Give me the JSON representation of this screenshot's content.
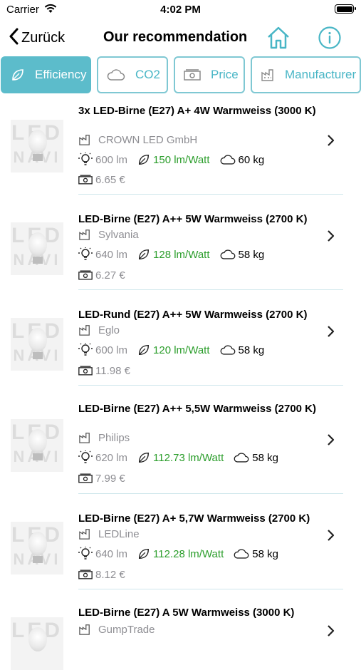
{
  "status": {
    "carrier": "Carrier",
    "time": "4:02 PM"
  },
  "nav": {
    "back_label": "Zurück",
    "title": "Our recommendation"
  },
  "filters": [
    {
      "label": "Efficiency",
      "icon": "leaf-icon",
      "active": true
    },
    {
      "label": "CO2",
      "icon": "cloud-icon",
      "active": false
    },
    {
      "label": "Price",
      "icon": "banknote-icon",
      "active": false
    },
    {
      "label": "Manufacturer",
      "icon": "factory-icon",
      "active": false
    }
  ],
  "thumbnail": {
    "text_line1": "LED",
    "text_line2": "NAVI"
  },
  "products": [
    {
      "name": "3x LED-Birne (E27) A+ 4W Warmweiss (3000  K)",
      "manufacturer": "CROWN LED GmbH",
      "lumen": "600 lm",
      "efficiency": "150 lm/Watt",
      "co2": "60 kg",
      "price": "6.65 €"
    },
    {
      "name": "LED-Birne (E27) A++ 5W Warmweiss (2700  K)",
      "manufacturer": "Sylvania",
      "lumen": "640 lm",
      "efficiency": "128 lm/Watt",
      "co2": "58 kg",
      "price": "6.27 €"
    },
    {
      "name": "LED-Rund (E27) A++ 5W Warmweiss (2700  K)",
      "manufacturer": "Eglo",
      "lumen": "600 lm",
      "efficiency": "120 lm/Watt",
      "co2": "58 kg",
      "price": "11.98 €"
    },
    {
      "name": "LED-Birne (E27) A++ 5,5W Warmweiss (2700  K)",
      "manufacturer": "Philips",
      "lumen": "620 lm",
      "efficiency": "112.73 lm/Watt",
      "co2": "58 kg",
      "price": "7.99 €"
    },
    {
      "name": "LED-Birne (E27) A+ 5,7W Warmweiss (2700  K)",
      "manufacturer": "LEDLine",
      "lumen": "640 lm",
      "efficiency": "112.28 lm/Watt",
      "co2": "58 kg",
      "price": "8.12 €"
    },
    {
      "name": "LED-Birne (E27) A 5W Warmweiss (3000  K)",
      "manufacturer": "GumpTrade",
      "lumen": "",
      "efficiency": "",
      "co2": "",
      "price": ""
    }
  ],
  "colors": {
    "accent": "#5cbccb",
    "accent_border": "#7fc8d3",
    "efficiency_green": "#2a9d2a",
    "muted": "#8e8e93"
  }
}
